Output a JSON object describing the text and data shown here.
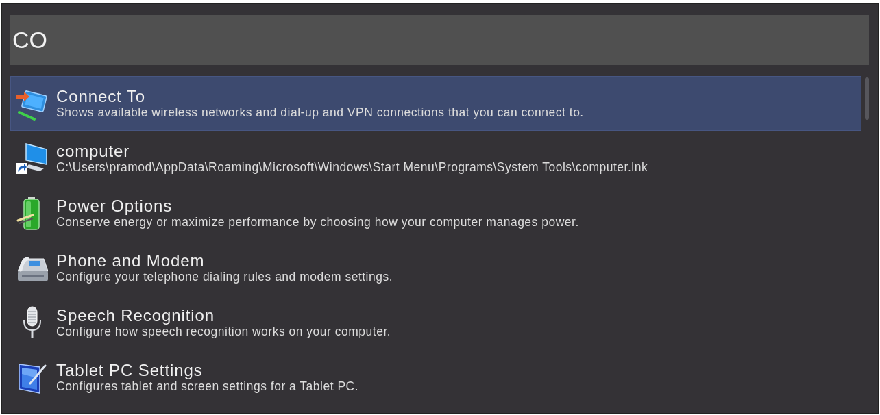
{
  "search": {
    "value": "CO"
  },
  "results": [
    {
      "title": "Connect To",
      "description": "Shows available wireless networks and dial-up and VPN connections that you can connect to.",
      "selected": true
    },
    {
      "title": "computer",
      "description": "C:\\Users\\pramod\\AppData\\Roaming\\Microsoft\\Windows\\Start Menu\\Programs\\System Tools\\computer.lnk",
      "selected": false
    },
    {
      "title": "Power Options",
      "description": "Conserve energy or maximize performance by choosing how your computer manages power.",
      "selected": false
    },
    {
      "title": "Phone and Modem",
      "description": "Configure your telephone dialing rules and modem settings.",
      "selected": false
    },
    {
      "title": "Speech Recognition",
      "description": "Configure how speech recognition works on your computer.",
      "selected": false
    },
    {
      "title": "Tablet PC Settings",
      "description": "Configures tablet and screen settings for a Tablet PC.",
      "selected": false
    }
  ]
}
